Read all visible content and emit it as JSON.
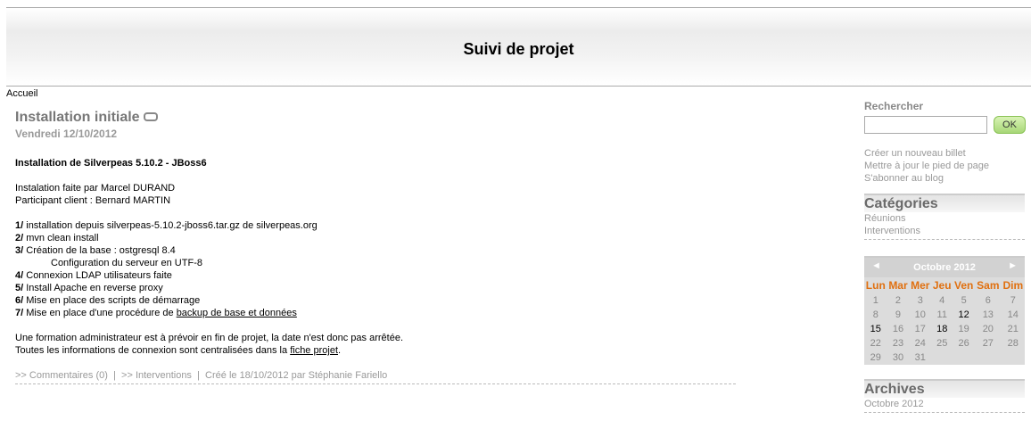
{
  "header": {
    "title": "Suivi de projet"
  },
  "breadcrumb": {
    "home": "Accueil"
  },
  "post": {
    "title": "Installation initiale",
    "date": "Vendredi 12/10/2012",
    "heading": "Installation de Silverpeas 5.10.2 - JBoss6",
    "intro": [
      "Instalation faite par Marcel DURAND",
      "Participant client : Bernard MARTIN"
    ],
    "steps": [
      {
        "num": "1/",
        "text": " installation depuis silverpeas-5.10.2-jboss6.tar.gz de silverpeas.org"
      },
      {
        "num": "2/",
        "text": " mvn clean install"
      },
      {
        "num": "3/",
        "text": " Création de la base : ostgresql 8.4"
      },
      {
        "num": "4/",
        "text": " Connexion LDAP utilisateurs faite"
      },
      {
        "num": "5/",
        "text": " Install Apache en reverse proxy"
      },
      {
        "num": "6/",
        "text": " Mise en place des scripts de démarrage"
      },
      {
        "num": "7/",
        "text": " Mise en place d'une procédure de ",
        "link": "backup de base et données"
      }
    ],
    "step3_sub": "Configuration du serveur en UTF-8",
    "closing1": "Une formation administrateur est à prévoir en fin de projet, la date n'est donc pas arrêtée.",
    "closing2_pre": "Toutes les informations de connexion sont centralisées dans la ",
    "closing2_link": "fiche projet",
    "closing2_post": ".",
    "meta": {
      "comments": ">> Commentaires (0)",
      "sep": "|",
      "category": ">> Interventions",
      "created": "Créé le 18/10/2012 par Stéphanie Fariello"
    }
  },
  "sidebar": {
    "search_label": "Rechercher",
    "search_value": "",
    "ok_label": "OK",
    "admin_links": [
      "Créer un nouveau billet",
      "Mettre à jour le pied de page",
      "S'abonner au blog"
    ],
    "categories_title": "Catégories",
    "categories": [
      "Réunions",
      "Interventions"
    ],
    "calendar": {
      "prev": "◄",
      "next": "►",
      "month": "Octobre 2012",
      "days": [
        "Lun",
        "Mar",
        "Mer",
        "Jeu",
        "Ven",
        "Sam",
        "Dim"
      ],
      "weeks": [
        [
          "1",
          "2",
          "3",
          "4",
          "5",
          "6",
          "7"
        ],
        [
          "8",
          "9",
          "10",
          "11",
          "12",
          "13",
          "14"
        ],
        [
          "15",
          "16",
          "17",
          "18",
          "19",
          "20",
          "21"
        ],
        [
          "22",
          "23",
          "24",
          "25",
          "26",
          "27",
          "28"
        ],
        [
          "29",
          "30",
          "31",
          "",
          "",
          "",
          ""
        ]
      ],
      "active_days": [
        "12",
        "15",
        "18"
      ]
    },
    "archives_title": "Archives",
    "archives": [
      "Octobre 2012"
    ]
  }
}
